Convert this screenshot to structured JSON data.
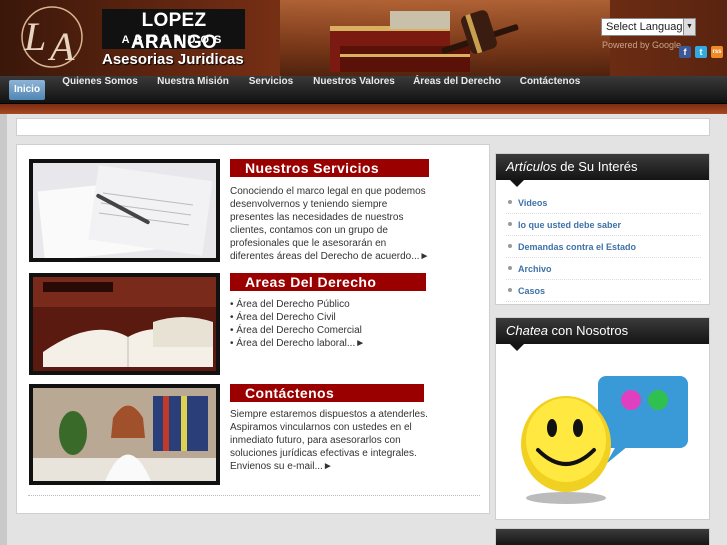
{
  "header": {
    "brand_name": "LOPEZ ARANGO",
    "brand_sub": "ABOGADOS",
    "tagline": "Asesorias Juridicas",
    "language_select": "Select Language",
    "powered_by": "Powered by Google",
    "social": [
      "f",
      "t",
      "rss"
    ]
  },
  "nav": {
    "items": [
      "Inicio",
      "Quienes Somos",
      "Nuestra Misión",
      "Servicios",
      "Nuestros Valores",
      "Áreas del Derecho",
      "Contáctenos"
    ]
  },
  "sections": [
    {
      "title": "Nuestros Servicios",
      "text": "Conociendo el marco legal en que podemos desenvolvernos y teniendo siempre presentes las necesidades de nuestros clientes, contamos con un grupo de profesionales que le asesorarán en diferentes áreas del Derecho de acuerdo...►"
    },
    {
      "title": "Areas Del Derecho",
      "bullets": [
        "• Área del Derecho Público",
        "• Área del Derecho Civil",
        "• Área del Derecho Comercial",
        "• Área del Derecho laboral...►"
      ]
    },
    {
      "title": "Contáctenos",
      "text": "Siempre estaremos dispuestos a atenderles. Aspiramos vincularnos con ustedes en el inmediato futuro, para asesorarlos con soluciones jurídicas efectivas e integrales. Envienos su e-mail...►"
    }
  ],
  "sidebar": {
    "articles": {
      "title_em": "Artículos",
      "title_rest": " de Su Interés",
      "links": [
        "Videos",
        "lo que usted debe saber",
        "Demandas contra el Estado",
        "Archivo",
        "Casos"
      ]
    },
    "chat": {
      "title_em": "Chatea",
      "title_rest": " con Nosotros"
    }
  },
  "colors": {
    "accent_red": "#9a0000",
    "link_blue": "#3e72a8",
    "nav_active": "#5a8fbd"
  }
}
